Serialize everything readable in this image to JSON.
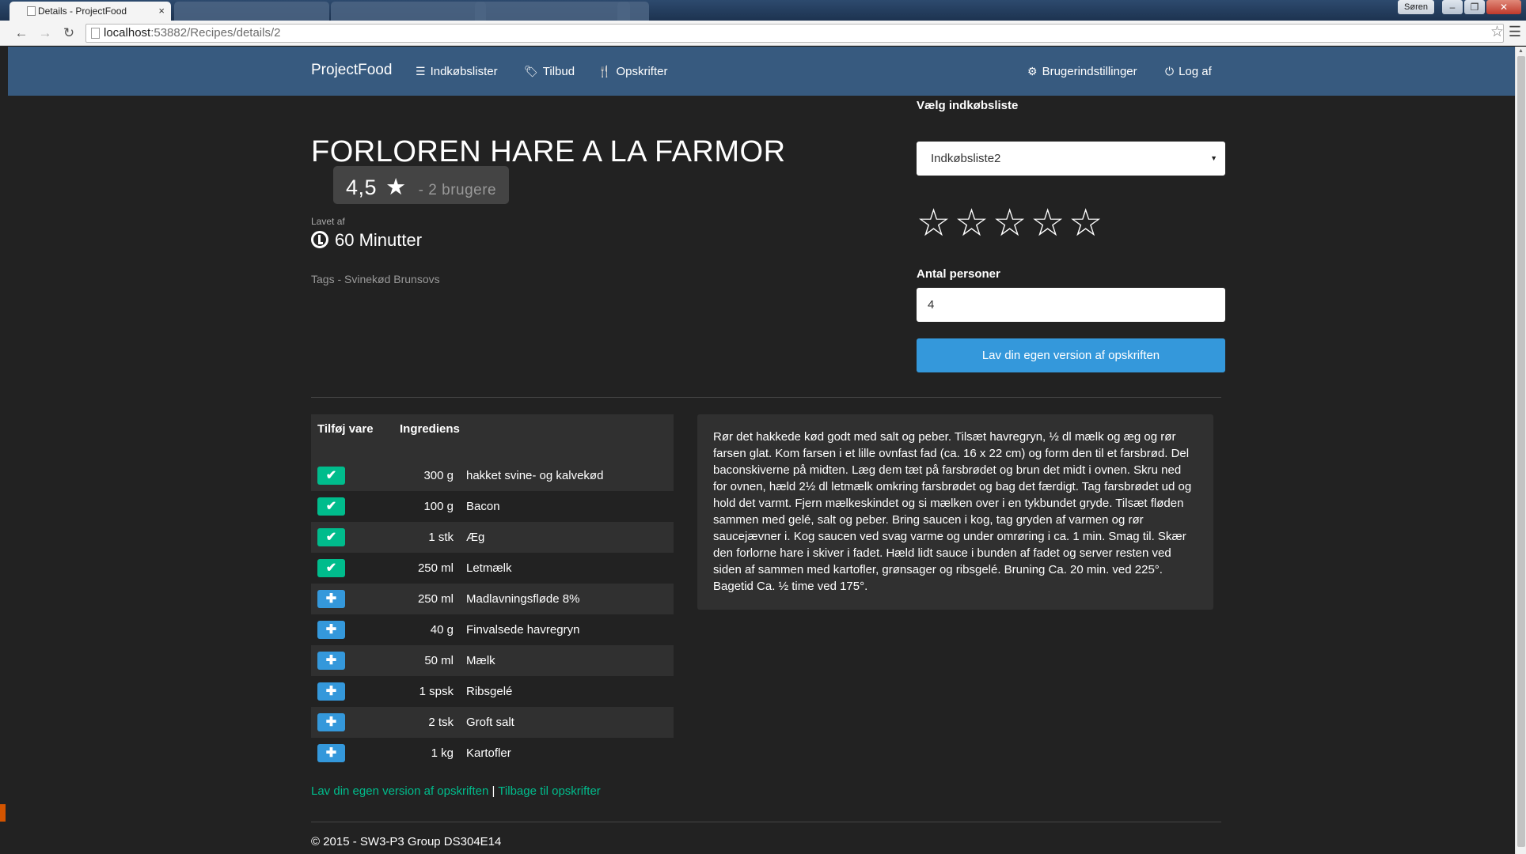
{
  "browser": {
    "active_tab_title": "Details - ProjectFood",
    "tab_close": "×",
    "inactive_tabs": [
      "",
      "",
      "",
      ""
    ],
    "user_chip": "Søren",
    "url_host": "localhost",
    "url_rest": ":53882/Recipes/details/2"
  },
  "navbar": {
    "brand": "ProjectFood",
    "items": [
      {
        "label": "Indkøbslister",
        "icon": "list-icon"
      },
      {
        "label": "Tilbud",
        "icon": "tags-icon"
      },
      {
        "label": "Opskrifter",
        "icon": "cutlery-icon"
      }
    ],
    "settings_label": "Brugerindstillinger",
    "logout_label": "Log af"
  },
  "recipe": {
    "title": "FORLOREN HARE A LA FARMOR",
    "rating_value": "4,5",
    "rating_users": "- 2 brugere",
    "made_by_label": "Lavet af",
    "time": "60 Minutter",
    "tags": "Tags - Svinekød Brunsovs"
  },
  "form": {
    "shopping_list_label": "Vælg indkøbsliste",
    "shopping_list_value": "Indkøbsliste2",
    "user_rating_stars": 5,
    "persons_label": "Antal personer",
    "persons_value": "4",
    "own_version_button": "Lav din egen version af opskriften"
  },
  "ingredients": {
    "header_add": "Tilføj vare",
    "header_name": "Ingrediens",
    "rows": [
      {
        "qty": "300 g",
        "name": "hakket svine- og kalvekød",
        "added": true
      },
      {
        "qty": "100 g",
        "name": "Bacon",
        "added": true
      },
      {
        "qty": "1 stk",
        "name": "Æg",
        "added": true
      },
      {
        "qty": "250 ml",
        "name": "Letmælk",
        "added": true
      },
      {
        "qty": "250 ml",
        "name": "Madlavningsfløde 8%",
        "added": false
      },
      {
        "qty": "40 g",
        "name": "Finvalsede havregryn",
        "added": false
      },
      {
        "qty": "50 ml",
        "name": "Mælk",
        "added": false
      },
      {
        "qty": "1 spsk",
        "name": "Ribsgelé",
        "added": false
      },
      {
        "qty": "2 tsk",
        "name": "Groft salt",
        "added": false
      },
      {
        "qty": "1 kg",
        "name": "Kartofler",
        "added": false
      }
    ]
  },
  "method": "Rør det hakkede kød godt med salt og peber. Tilsæt havregryn, ½ dl mælk og æg og rør farsen glat. Kom farsen i et lille ovnfast fad (ca. 16 x 22 cm) og form den til et farsbrød. Del baconskiverne på midten. Læg dem tæt på farsbrødet og brun det midt i ovnen. Skru ned for ovnen, hæld 2½ dl letmælk omkring farsbrødet og bag det færdigt. Tag farsbrødet ud og hold det varmt. Fjern mælkeskindet og si mælken over i en tykbundet gryde. Tilsæt fløden sammen med gelé, salt og peber. Bring saucen i kog, tag gryden af varmen og rør saucejævner i. Kog saucen ved svag varme og under omrøring i ca. 1 min. Smag til. Skær den forlorne hare i skiver i fadet. Hæld lidt sauce i bunden af fadet og server resten ved siden af sammen med kartofler, grønsager og ribsgelé. Bruning Ca. 20 min. ved 225°. Bagetid Ca. ½ time ved 175°.",
  "footer": {
    "own_version_link": "Lav din egen version af opskriften",
    "separator": "|",
    "back_link": "Tilbage til opskrifter",
    "copyright": "© 2015 - SW3-P3 Group DS304E14"
  },
  "colors": {
    "navbar": "#375a7f",
    "page_bg": "#222222",
    "added_green": "#00bc8c",
    "add_blue": "#3498db"
  }
}
